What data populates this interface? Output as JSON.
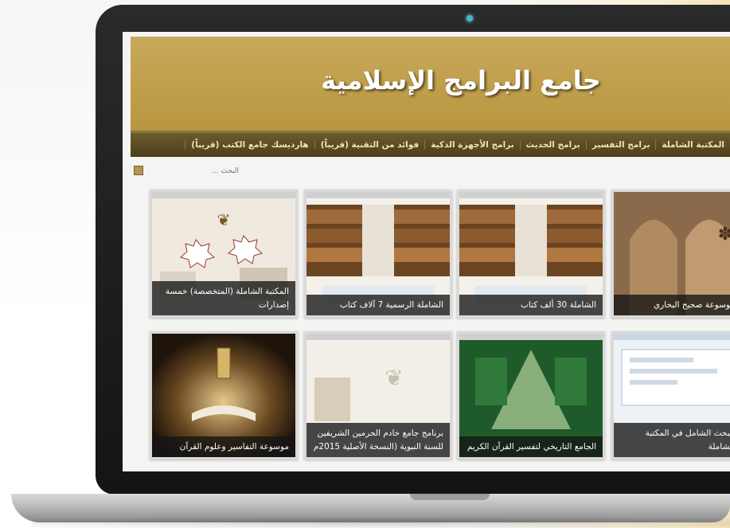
{
  "site": {
    "title": "جامع البرامج الإسلامية"
  },
  "nav": {
    "items": [
      "المكتبة الشاملة",
      "برامج التفسير",
      "برامج الحديث",
      "برامج الأجهزة الذكية",
      "فوائد من التقنية (قريباً)",
      "هارديسك جامع الكتب (قريباً)"
    ]
  },
  "search": {
    "placeholder": "البحث ..."
  },
  "cards": [
    {
      "caption": "موسوعة صحيح البخاري",
      "image": "bukhari-arch-image"
    },
    {
      "caption": "الشاملة 30 ألف كتاب",
      "image": "library-shelves-image"
    },
    {
      "caption": "الشاملة الرسمية 7 آلاف كتاب",
      "image": "library-shelves-image"
    },
    {
      "caption": "المكتبة الشاملة (المتخصصة) خمسة إصدارات",
      "image": "shamela-logo-image"
    },
    {
      "caption": "البحث الشامل في المكتبة الشاملة",
      "image": "search-app-screenshot"
    },
    {
      "caption": "الجامع التاريخي لتفسير القرآن الكريم",
      "image": "tafsir-app-screenshot"
    },
    {
      "caption": "برنامج جامع خادم الحرمين الشريفين للسنة النبوية (النسخة الأصلية 2015م",
      "image": "sunnah-app-screenshot"
    },
    {
      "caption": "موسوعة التفاسير وعلوم القرآن",
      "image": "quran-lantern-image"
    }
  ],
  "colors": {
    "header_gold": "#b8963f",
    "nav_brown": "#4c3e1c",
    "nav_text": "#f3e3b0"
  }
}
